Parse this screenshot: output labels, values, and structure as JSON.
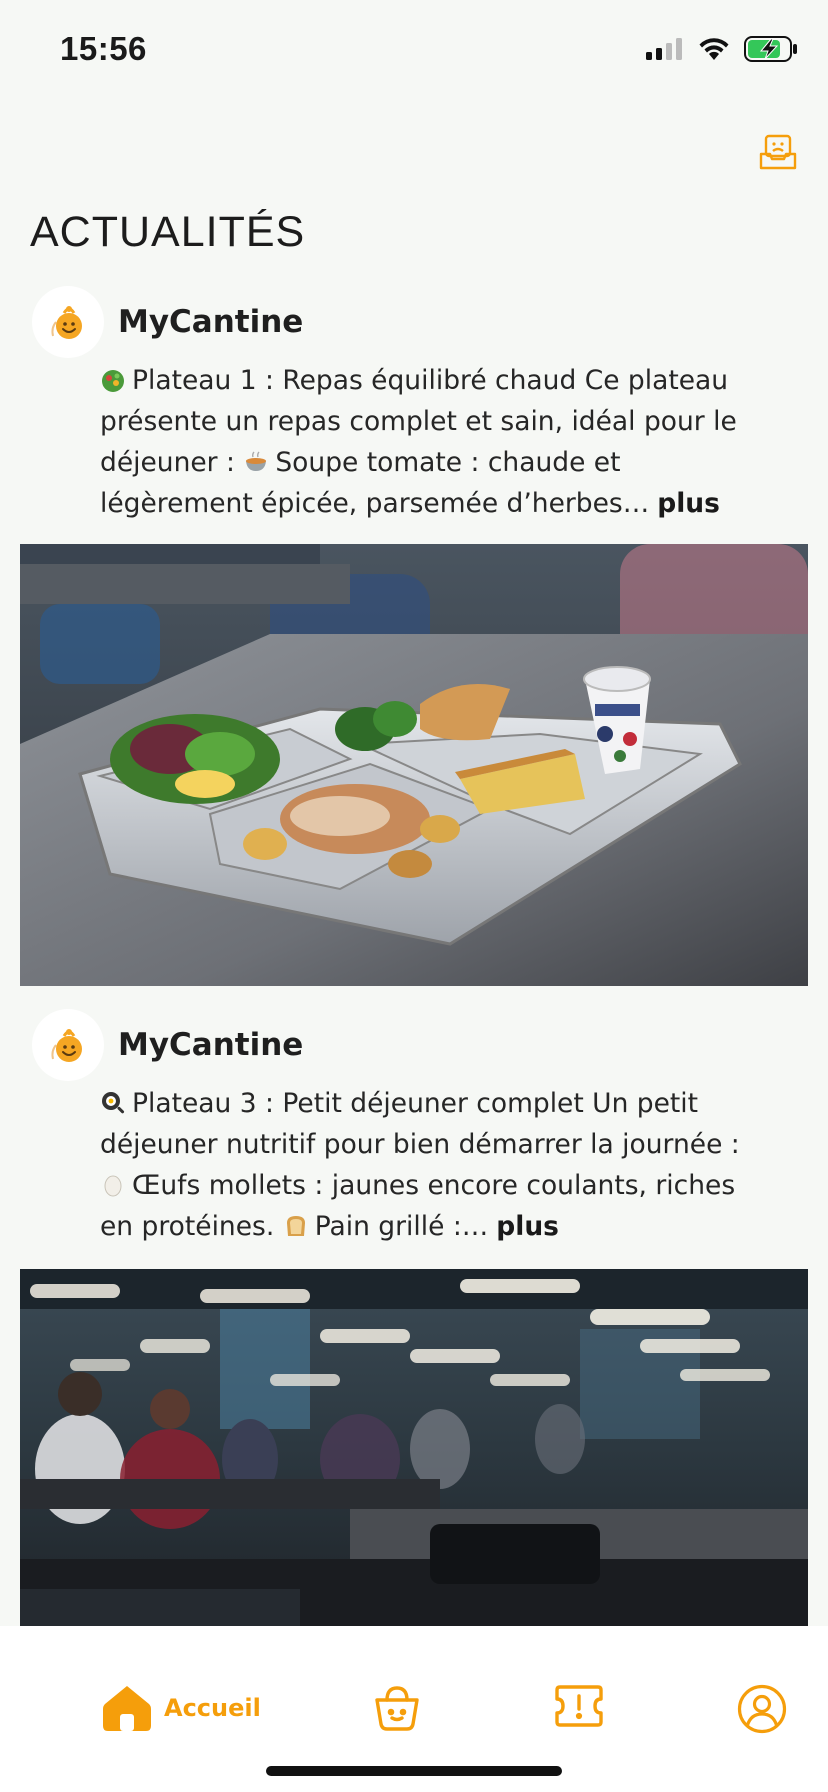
{
  "status": {
    "time": "15:56"
  },
  "header": {
    "section_title": "ACTUALITÉS"
  },
  "posts": [
    {
      "author": "MyCantine",
      "segments": [
        "Plateau 1 : Repas équilibré chaud Ce plateau présente un repas complet et sain, idéal pour le déjeuner : ",
        "Soupe tomate : chaude et légèrement épicée, parsemée d’herbes…"
      ],
      "emojis": [
        "salad-emoji",
        "soup-bowl-emoji"
      ],
      "more_label": "plus",
      "image": "cafeteria-tray-meal-photo"
    },
    {
      "author": "MyCantine",
      "segments": [
        "Plateau 3 : Petit déjeuner complet Un petit déjeuner nutritif pour bien démarrer la journée : ",
        "Œufs mollets : jaunes encore coulants, riches en protéines. ",
        "Pain grillé :…"
      ],
      "emojis": [
        "frying-pan-emoji",
        "egg-emoji",
        "bread-emoji"
      ],
      "more_label": "plus",
      "image": "cafeteria-dining-hall-photo"
    }
  ],
  "tabbar": {
    "items": [
      {
        "label": "Accueil",
        "icon": "home-icon",
        "active": true
      },
      {
        "label": "",
        "icon": "basket-icon",
        "active": false
      },
      {
        "label": "",
        "icon": "ticket-icon",
        "active": false
      },
      {
        "label": "",
        "icon": "profile-icon",
        "active": false
      }
    ]
  },
  "colors": {
    "accent": "#f59e0b",
    "background": "#f6f8f5"
  }
}
